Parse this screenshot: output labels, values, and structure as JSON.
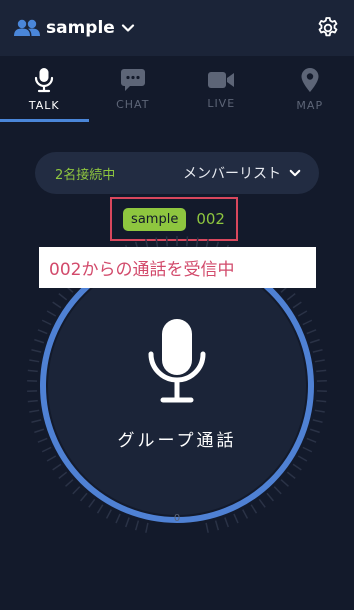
{
  "header": {
    "group_name": "sample",
    "group_icon": "group-users-icon",
    "settings_icon": "gear-icon"
  },
  "tabs": [
    {
      "label": "TALK",
      "icon": "microphone-icon",
      "active": true
    },
    {
      "label": "CHAT",
      "icon": "chat-bubble-icon",
      "active": false
    },
    {
      "label": "LIVE",
      "icon": "video-camera-icon",
      "active": false
    },
    {
      "label": "MAP",
      "icon": "map-pin-icon",
      "active": false
    }
  ],
  "members": {
    "connected_status": "2名接続中",
    "member_list_label": "メンバーリスト"
  },
  "speaker": {
    "group_badge": "sample",
    "speaker_id": "002"
  },
  "notification": {
    "incoming_call_text": "002からの通話を受信中"
  },
  "call": {
    "button_label": "グループ通話",
    "level_value": "0"
  },
  "colors": {
    "background": "#131a2b",
    "header": "#1b2438",
    "accent_blue": "#4a86d9",
    "green": "#8ec63f",
    "highlight_red": "#d9475d",
    "banner_text": "#d24a6b"
  }
}
